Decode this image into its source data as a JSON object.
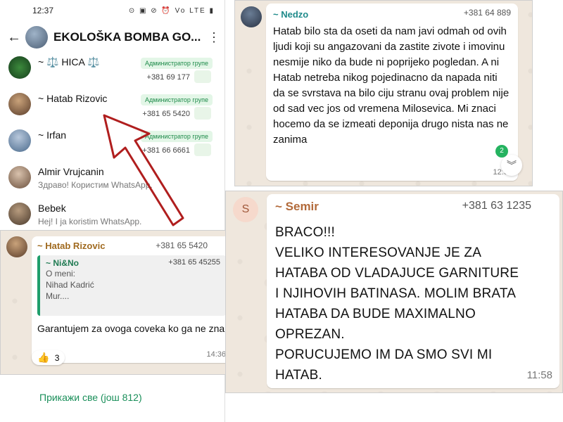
{
  "group_panel": {
    "status_time": "12:37",
    "status_icons": "⊙ ▣  ⊘ ⏰ Vo LTE ▮",
    "title": "EKOLOŠKA BOMBA GO...",
    "back_icon": "arrow-left-icon",
    "menu_icon": "more-vert-icon",
    "members": [
      {
        "name": "~ ⚖️ HICA ⚖️",
        "phone": "+381 69 177",
        "admin": "Администратор групе",
        "status": "",
        "avatar_color": "#1e5b2a"
      },
      {
        "name": "~ Hatab Rizovic",
        "phone": "+381 65 5420",
        "admin": "Администратор групе",
        "status": "",
        "avatar_color": "#8a6b4e"
      },
      {
        "name": "~ Irfan",
        "phone": "+381 66 6661",
        "admin": "Администратор групе",
        "status": "",
        "avatar_color": "#6f8fb0"
      },
      {
        "name": "Almir Vrujcanin",
        "phone": "",
        "admin": "",
        "status": "Здраво! Користим WhatsApp.",
        "avatar_color": "#9a7c66"
      },
      {
        "name": "Bebek",
        "phone": "",
        "admin": "",
        "status": "Hej! I ja koristim WhatsApp.",
        "avatar_color": "#7a6a5a"
      }
    ],
    "show_all": "Прикажи све (још 812)"
  },
  "message_hatab": {
    "sender": "~ Hatab Rizovic",
    "sender_color": "#a06a1f",
    "phone": "+381 65 5420",
    "quote": {
      "name": "~ Ni&No",
      "phone": "+381 65 45255",
      "lines": [
        "O meni:",
        "Nihad Kadrić",
        "Mur...."
      ]
    },
    "text": "Garantujem za ovoga coveka ko ga ne zna",
    "time": "14:36",
    "reaction_emoji": "👍",
    "reaction_count": "3"
  },
  "message_nedzo": {
    "sender": "~ Nedzo",
    "sender_color": "#1f8a8a",
    "phone": "+381 64 889",
    "text": "Hatab bilo sta da oseti da nam javi odmah od ovih ljudi koji su angazovani da zastite zivote i imovinu nesmije niko da bude ni poprijeko pogledan. A ni Hatab netreba nikog pojedinacno da napada niti da se svrstava na bilo ciju stranu ovaj problem nije od sad vec jos od vremena Milosevica. Mi znaci hocemo da se izmeati deponija drugo nista nas ne zanima",
    "time": "12:04",
    "unread_count": "2",
    "scroll_icon": "chevron-double-down-icon"
  },
  "message_semir": {
    "avatar_letter": "S",
    "sender": "~ Semir",
    "sender_color": "#b26a3a",
    "phone": "+381 63 1235",
    "text_lines": [
      "BRACO!!!",
      "VELIKO INTERESOVANJE JE ZA",
      "HATABA OD VLADAJUCE GARNITURE",
      "I NJIHOVIH BATINASA. MOLIM BRATA",
      "HATABA DA BUDE MAXIMALNO",
      "OPREZAN.",
      "PORUCUJEMO IM DA SMO SVI MI",
      "HATAB."
    ],
    "time": "11:58"
  }
}
